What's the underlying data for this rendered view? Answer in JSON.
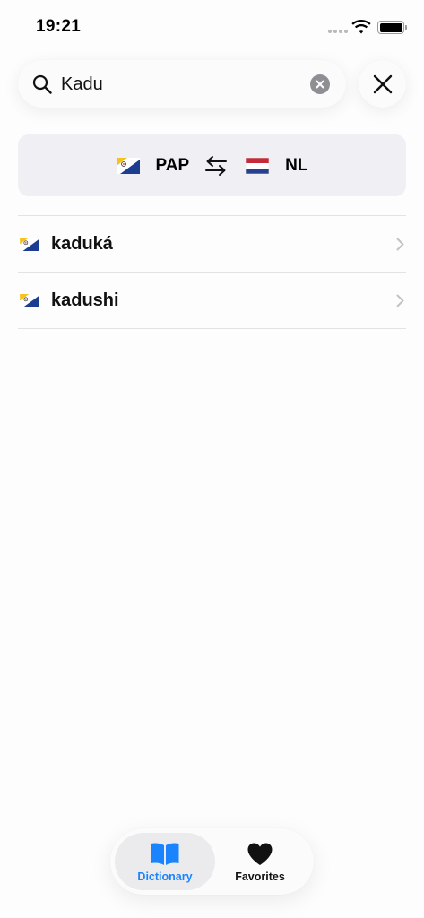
{
  "status_bar": {
    "time": "19:21"
  },
  "search": {
    "value": "Kadu",
    "placeholder": ""
  },
  "language_switch": {
    "source": "PAP",
    "target": "NL"
  },
  "results": [
    {
      "word": "kaduká"
    },
    {
      "word": "kadushi"
    }
  ],
  "tab_bar": {
    "tabs": [
      {
        "label": "Dictionary",
        "icon": "book-icon",
        "active": true
      },
      {
        "label": "Favorites",
        "icon": "heart-icon",
        "active": false
      }
    ]
  },
  "colors": {
    "accent": "#1a84ff",
    "flag_blue": "#1d3d91",
    "flag_yellow": "#f7c21a",
    "nl_red": "#c52a38",
    "nl_blue": "#27408f"
  }
}
